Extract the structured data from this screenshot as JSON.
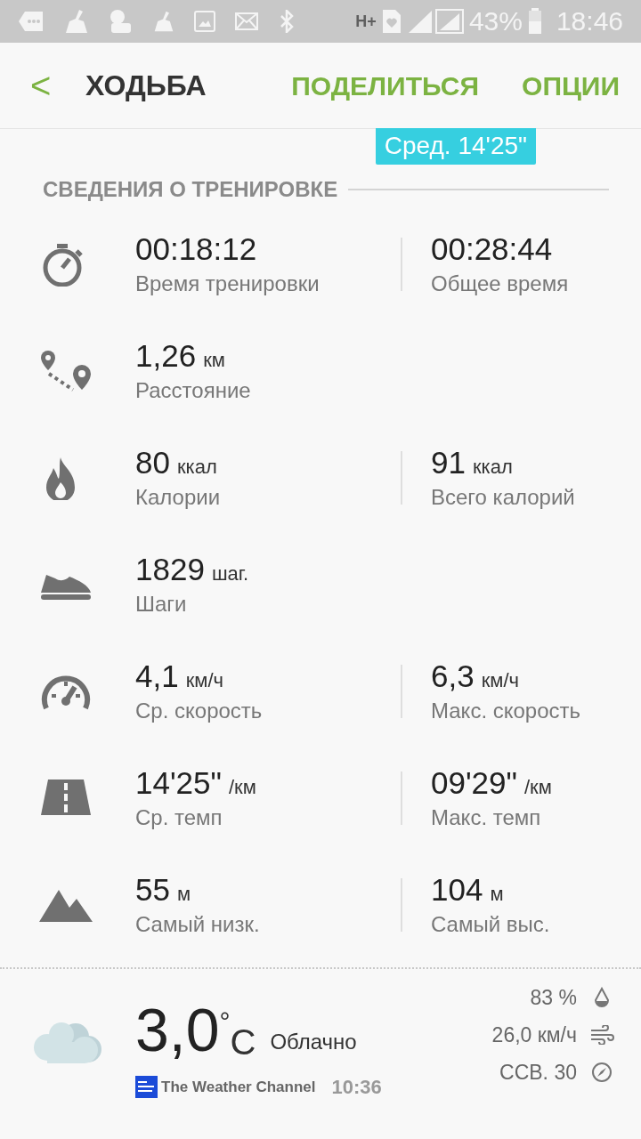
{
  "status_bar": {
    "network": "H+",
    "battery": "43%",
    "time": "18:46"
  },
  "header": {
    "back": "<",
    "title": "ХОДЬБА",
    "actions": [
      "ПОДЕЛИТЬСЯ",
      "ОПЦИИ"
    ]
  },
  "average_badge": "Сред. 14'25\"",
  "section_title": "СВЕДЕНИЯ О ТРЕНИРОВКЕ",
  "stats": [
    {
      "items": [
        {
          "value": "00:18:12",
          "label": "Время тренировки"
        },
        {
          "value": "00:28:44",
          "label": "Общее время"
        }
      ]
    },
    {
      "items": [
        {
          "value": "1,26",
          "unit": "км",
          "label": "Расстояние"
        }
      ]
    },
    {
      "items": [
        {
          "value": "80",
          "unit": "ккал",
          "label": "Калории"
        },
        {
          "value": "91",
          "unit": "ккал",
          "label": "Всего калорий"
        }
      ]
    },
    {
      "items": [
        {
          "value": "1829",
          "unit": "шаг.",
          "label": "Шаги"
        }
      ]
    },
    {
      "items": [
        {
          "value": "4,1",
          "unit": "км/ч",
          "label": "Ср. скорость"
        },
        {
          "value": "6,3",
          "unit": "км/ч",
          "label": "Макс. скорость"
        }
      ]
    },
    {
      "items": [
        {
          "value": "14'25\"",
          "unit": "/км",
          "label": "Ср. темп"
        },
        {
          "value": "09'29\"",
          "unit": "/км",
          "label": "Макс. темп"
        }
      ]
    },
    {
      "items": [
        {
          "value": "55",
          "unit": "м",
          "label": "Самый низк."
        },
        {
          "value": "104",
          "unit": "м",
          "label": "Самый выс."
        }
      ]
    }
  ],
  "weather": {
    "temperature": "3,0",
    "degree": "°",
    "scale": "C",
    "condition": "Облачно",
    "provider": "The Weather Channel",
    "updated": "10:36",
    "humidity": "83 %",
    "wind_speed": "26,0 км/ч",
    "wind_direction": "ССВ. 30"
  }
}
